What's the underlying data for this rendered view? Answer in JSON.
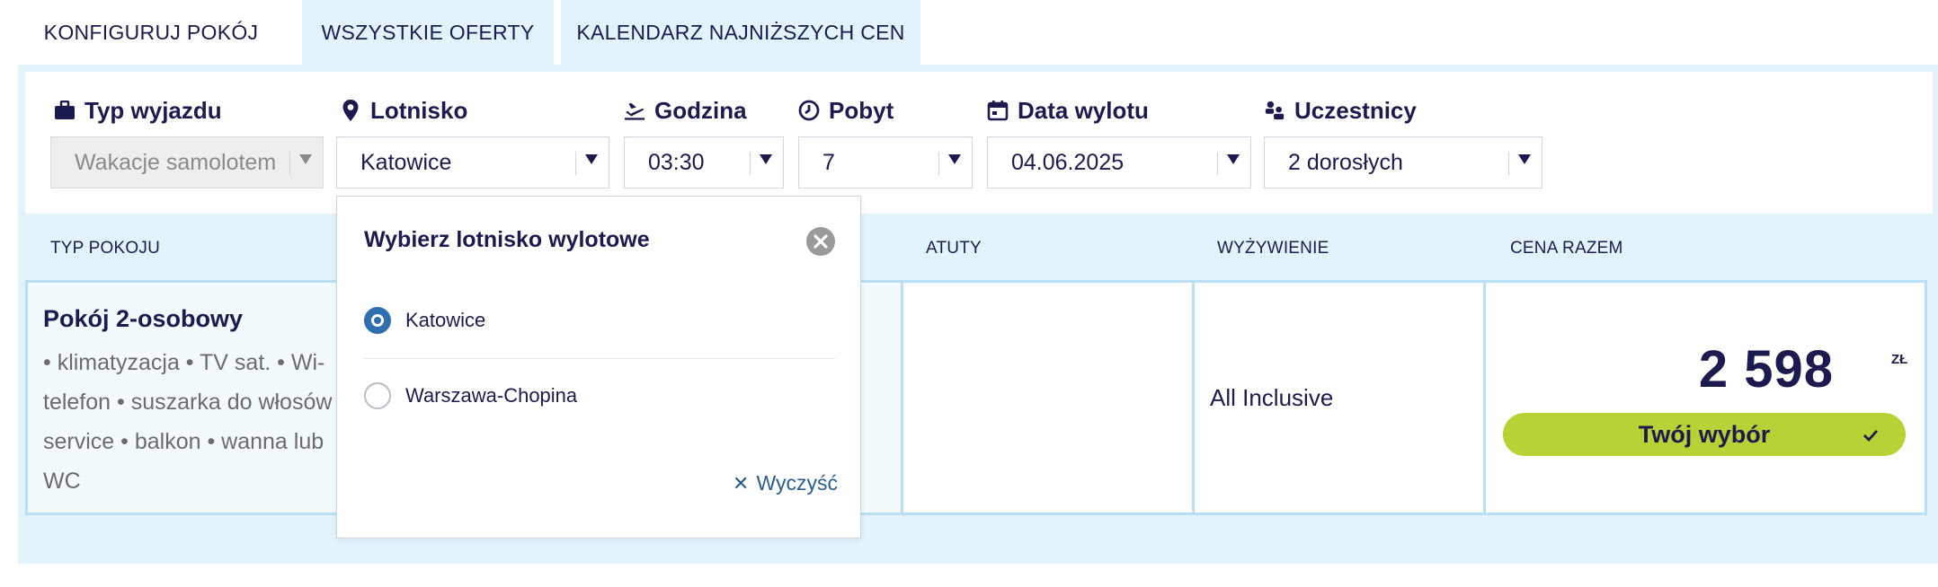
{
  "tabs": [
    {
      "label": "KONFIGURUJ POKÓJ",
      "active": true
    },
    {
      "label": "WSZYSTKIE OFERTY",
      "active": false
    },
    {
      "label": "KALENDARZ NAJNIŻSZYCH CEN",
      "active": false
    }
  ],
  "filters": {
    "trip_type": {
      "label": "Typ wyjazdu",
      "value": "Wakacje samolotem",
      "icon": "suitcase-icon",
      "disabled": true
    },
    "airport": {
      "label": "Lotnisko",
      "value": "Katowice",
      "icon": "location-pin-icon"
    },
    "time": {
      "label": "Godzina",
      "value": "03:30",
      "icon": "plane-departure-icon"
    },
    "stay": {
      "label": "Pobyt",
      "value": "7",
      "icon": "clock-icon"
    },
    "departure_date": {
      "label": "Data wylotu",
      "value": "04.06.2025",
      "icon": "calendar-icon"
    },
    "participants": {
      "label": "Uczestnicy",
      "value": "2 dorosłych",
      "icon": "people-icon"
    }
  },
  "table": {
    "headers": {
      "room_type": "TYP POKOJU",
      "atuty": "ATUTY",
      "meal": "WYŻYWIENIE",
      "price": "CENA RAZEM"
    },
    "row": {
      "title": "Pokój 2-osobowy",
      "amenities": "• klimatyzacja • TV sat. • Wi-\ntelefon • suszarka do włosów\nservice • balkon • wanna lub\nWC",
      "meal": "All Inclusive",
      "price": "2 598",
      "currency": "zł",
      "choice_label": "Twój wybór"
    }
  },
  "airport_popup": {
    "title": "Wybierz lotnisko wylotowe",
    "options": [
      {
        "label": "Katowice",
        "selected": true
      },
      {
        "label": "Warszawa-Chopina",
        "selected": false
      }
    ],
    "clear_label": "Wyczyść"
  },
  "colors": {
    "navy": "#1b1b4f",
    "panel_bg": "#e3f3fc",
    "accent_green": "#b5d334",
    "border_blue": "#b9dff4",
    "radio_blue": "#2f6fb0"
  }
}
